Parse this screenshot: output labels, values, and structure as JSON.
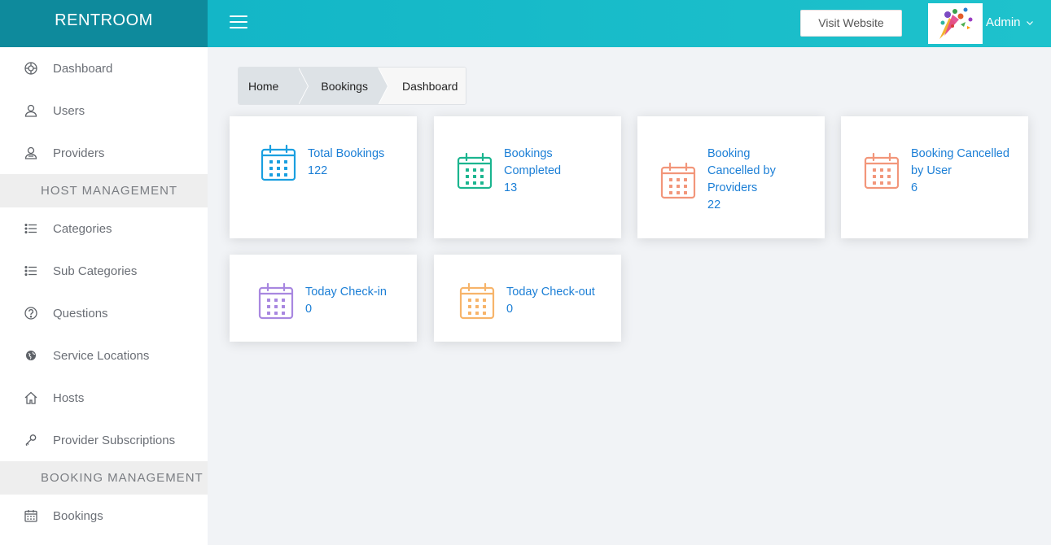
{
  "brand": {
    "title": "RENTROOM"
  },
  "sidebar": {
    "items_top": [
      {
        "label": "Dashboard",
        "icon": "dashboard-icon"
      },
      {
        "label": "Users",
        "icon": "user-icon"
      },
      {
        "label": "Providers",
        "icon": "provider-icon"
      }
    ],
    "section_host": "HOST MANAGEMENT",
    "items_host": [
      {
        "label": "Categories",
        "icon": "list-icon"
      },
      {
        "label": "Sub Categories",
        "icon": "list-icon"
      },
      {
        "label": "Questions",
        "icon": "question-icon"
      },
      {
        "label": "Service Locations",
        "icon": "globe-icon"
      },
      {
        "label": "Hosts",
        "icon": "home-icon"
      },
      {
        "label": "Provider Subscriptions",
        "icon": "key-icon"
      }
    ],
    "section_booking": "BOOKING MANAGEMENT",
    "items_booking": [
      {
        "label": "Bookings",
        "icon": "calendar-icon"
      }
    ]
  },
  "topbar": {
    "visit_label": "Visit Website",
    "admin_label": "Admin"
  },
  "breadcrumb": [
    "Home",
    "Bookings",
    "Dashboard"
  ],
  "cards": [
    {
      "label": "Total Bookings",
      "value": "122",
      "color": "#1a9fe0"
    },
    {
      "label": "Bookings Completed",
      "value": "13",
      "color": "#1bb58f"
    },
    {
      "label": "Booking Cancelled by Providers",
      "value": "22",
      "color": "#f2967a"
    },
    {
      "label": "Booking Cancelled by User",
      "value": "6",
      "color": "#f2967a"
    },
    {
      "label": "Today Check-in",
      "value": "0",
      "color": "#a887e0"
    },
    {
      "label": "Today Check-out",
      "value": "0",
      "color": "#f7b46a"
    }
  ],
  "colors": {
    "accent": "#13b6c7",
    "brand_bg": "#0e8a9c",
    "link": "#1c7fd6"
  }
}
